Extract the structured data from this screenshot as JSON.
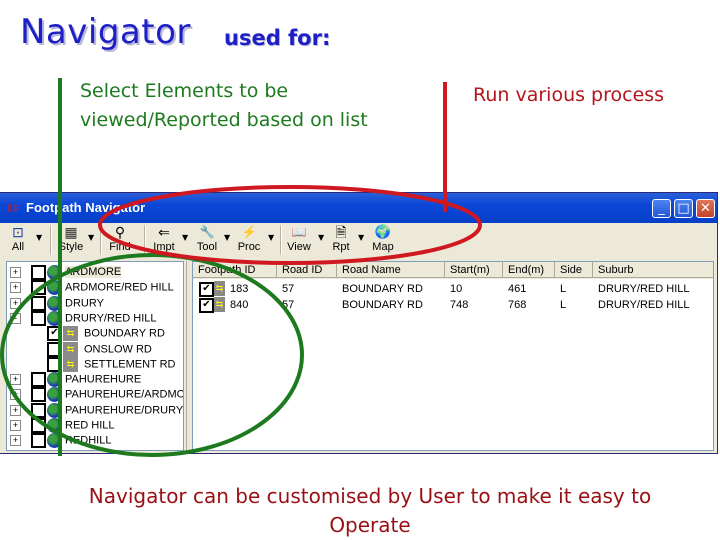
{
  "slide": {
    "title": "Navigator",
    "subtitle": "used for:",
    "note_left_line1": "Select Elements to be",
    "note_left_line2": "viewed/Reported based on list",
    "note_right": "Run various process",
    "bottom_line1": "Navigator can be customised by User to make it easy to",
    "bottom_line2": "Operate",
    "colors": {
      "title": "#1f1fc8",
      "green_annotation": "#1e7a1e",
      "red_annotation": "#d01820"
    }
  },
  "window": {
    "title": "Footpath Navigator",
    "controls": {
      "minimize": "_",
      "maximize": "□",
      "close": "✕"
    }
  },
  "toolbar": {
    "items": [
      {
        "label": "All",
        "icon": "select-all-icon",
        "glyph": "⊡"
      },
      {
        "label": "Style",
        "icon": "style-grid-icon",
        "glyph": "▦"
      },
      {
        "label": "Find",
        "icon": "binoculars-icon",
        "glyph": "⚲"
      },
      {
        "label": "Impt",
        "icon": "import-icon",
        "glyph": "⇐"
      },
      {
        "label": "Tool",
        "icon": "wrench-icon",
        "glyph": "🔧"
      },
      {
        "label": "Proc",
        "icon": "lightning-icon",
        "glyph": "⚡"
      },
      {
        "label": "View",
        "icon": "book-icon",
        "glyph": "📖"
      },
      {
        "label": "Rpt",
        "icon": "report-icon",
        "glyph": "🗎"
      },
      {
        "label": "Map",
        "icon": "globe-icon",
        "glyph": "🌍"
      }
    ]
  },
  "tree": {
    "items": [
      {
        "label": "ARDMORE",
        "level": 0,
        "expander": "+",
        "checked": false,
        "selected": true
      },
      {
        "label": "ARDMORE/RED HILL",
        "level": 0,
        "expander": "+",
        "checked": false
      },
      {
        "label": "DRURY",
        "level": 0,
        "expander": "+",
        "checked": false
      },
      {
        "label": "DRURY/RED HILL",
        "level": 0,
        "expander": "-",
        "checked": false
      },
      {
        "label": "BOUNDARY RD",
        "level": 1,
        "checked": true
      },
      {
        "label": "ONSLOW RD",
        "level": 1,
        "checked": false
      },
      {
        "label": "SETTLEMENT RD",
        "level": 1,
        "checked": false
      },
      {
        "label": "PAHUREHURE",
        "level": 0,
        "expander": "+",
        "checked": false
      },
      {
        "label": "PAHUREHURE/ARDMORE",
        "level": 0,
        "expander": "+",
        "checked": false
      },
      {
        "label": "PAHUREHURE/DRURY",
        "level": 0,
        "expander": "+",
        "checked": false
      },
      {
        "label": "RED HILL",
        "level": 0,
        "expander": "+",
        "checked": false
      },
      {
        "label": "REDHILL",
        "level": 0,
        "expander": "+",
        "checked": false
      }
    ]
  },
  "grid": {
    "columns": [
      "Footpath ID",
      "Road ID",
      "Road Name",
      "Start(m)",
      "End(m)",
      "Side",
      "Suburb"
    ],
    "rows": [
      {
        "checked": true,
        "cells": [
          "183",
          "57",
          "BOUNDARY RD",
          "10",
          "461",
          "L",
          "DRURY/RED HILL"
        ]
      },
      {
        "checked": true,
        "cells": [
          "840",
          "57",
          "BOUNDARY RD",
          "748",
          "768",
          "L",
          "DRURY/RED HILL"
        ]
      }
    ]
  }
}
